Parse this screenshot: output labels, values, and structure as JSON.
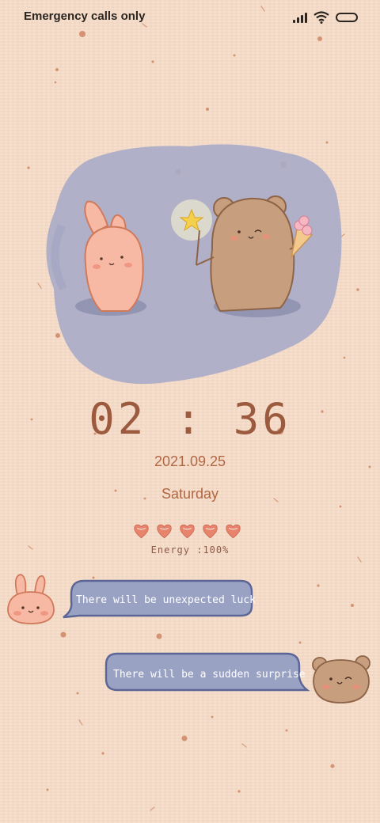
{
  "status_bar": {
    "carrier_text": "Emergency calls only",
    "icons": [
      "signal-icon",
      "wifi-icon",
      "battery-icon"
    ]
  },
  "clock": {
    "time": "02 : 36",
    "date": "2021.09.25",
    "day": "Saturday"
  },
  "energy": {
    "hearts_filled": 5,
    "hearts_total": 5,
    "label": "Energy :100%"
  },
  "messages": [
    {
      "from": "bunny",
      "text": "There will be unexpected luck"
    },
    {
      "from": "bear",
      "text": "There will be a sudden surprise"
    }
  ],
  "colors": {
    "background": "#f7dcc8",
    "text_brown": "#9c5a3e",
    "accent_orange": "#b06744",
    "heart": "#e8846c",
    "bubble_fill": "#9aa2c4",
    "bubble_border": "#5b6596",
    "bunny": "#f8b9a4",
    "bear": "#c79f7e"
  }
}
